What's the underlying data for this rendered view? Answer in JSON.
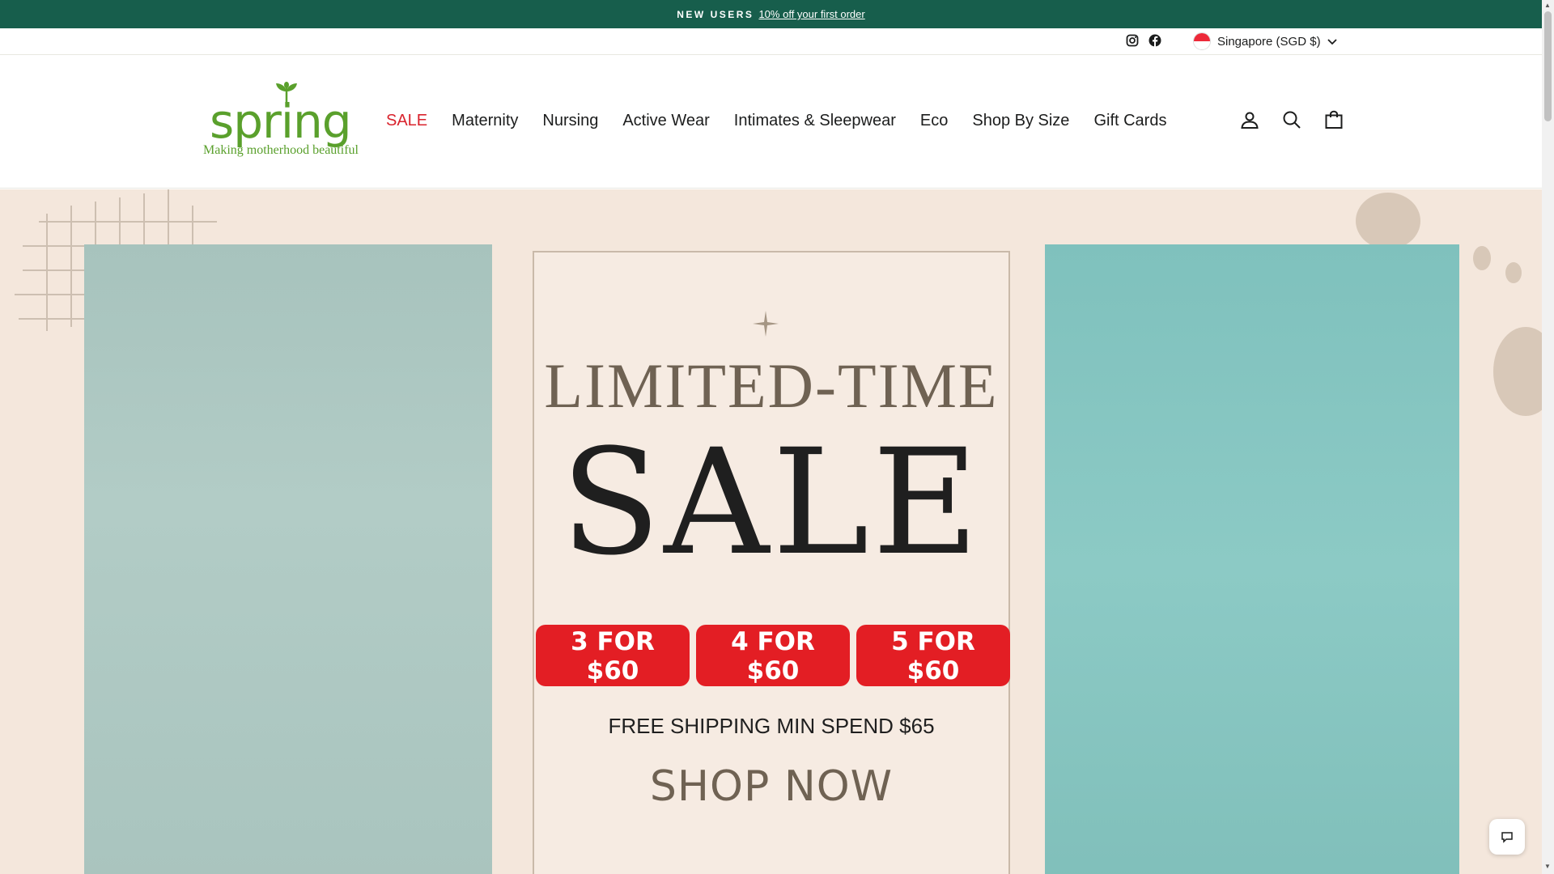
{
  "announcement": {
    "label": "NEW USERS",
    "link_text": "10% off your first order"
  },
  "utility": {
    "social_icons": [
      "instagram-icon",
      "facebook-icon"
    ],
    "currency_label": "Singapore (SGD $)"
  },
  "header": {
    "logo": {
      "word": "spring",
      "tagline": "Making motherhood beautiful",
      "color": "#5aa02c"
    },
    "nav": [
      {
        "label": "SALE"
      },
      {
        "label": "Maternity"
      },
      {
        "label": "Nursing"
      },
      {
        "label": "Active Wear"
      },
      {
        "label": "Intimates & Sleepwear"
      },
      {
        "label": "Eco"
      },
      {
        "label": "Shop By Size"
      },
      {
        "label": "Gift Cards"
      }
    ],
    "icons": [
      "account-icon",
      "search-icon",
      "cart-icon"
    ]
  },
  "hero": {
    "headline_top": "LIMITED-TIME",
    "headline_main": "SALE",
    "deals": [
      {
        "line1": "3 FOR",
        "line2": "$60"
      },
      {
        "line1": "4 FOR",
        "line2": "$60"
      },
      {
        "line1": "5 FOR",
        "line2": "$60"
      }
    ],
    "shipping": "FREE SHIPPING MIN SPEND $65",
    "cta": "SHOP NOW",
    "colors": {
      "background": "#f4e7dc",
      "deal": "#e31e24"
    }
  },
  "colors": {
    "announce_bg": "#175e4c",
    "sale_nav": "#d9232d"
  }
}
